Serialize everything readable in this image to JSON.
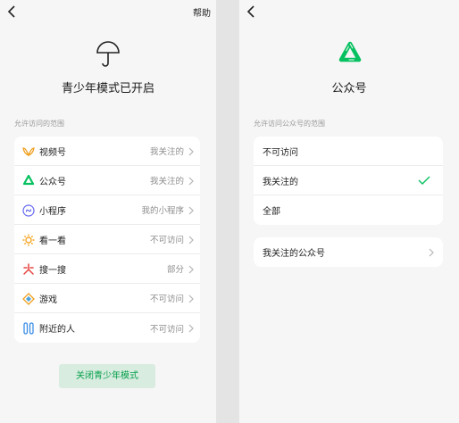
{
  "left": {
    "help_label": "帮助",
    "title": "青少年模式已开启",
    "section_label": "允许访问的范围",
    "items": [
      {
        "label": "视频号",
        "value": "我关注的",
        "icon": "video-channel-icon"
      },
      {
        "label": "公众号",
        "value": "我关注的",
        "icon": "official-account-icon"
      },
      {
        "label": "小程序",
        "value": "我的小程序",
        "icon": "mini-program-icon"
      },
      {
        "label": "看一看",
        "value": "不可访问",
        "icon": "top-stories-icon"
      },
      {
        "label": "搜一搜",
        "value": "部分",
        "icon": "search-icon"
      },
      {
        "label": "游戏",
        "value": "不可访问",
        "icon": "game-icon"
      },
      {
        "label": "附近的人",
        "value": "不可访问",
        "icon": "people-nearby-icon"
      }
    ],
    "close_button": "关闭青少年模式"
  },
  "right": {
    "title": "公众号",
    "section_label": "允许访问公众号的范围",
    "options": [
      {
        "label": "不可访问",
        "selected": false
      },
      {
        "label": "我关注的",
        "selected": true
      },
      {
        "label": "全部",
        "selected": false
      }
    ],
    "followed_link": "我关注的公众号"
  },
  "colors": {
    "accent_green": "#07c160",
    "button_bg": "#d8ece0",
    "background": "#f6f6f6"
  }
}
